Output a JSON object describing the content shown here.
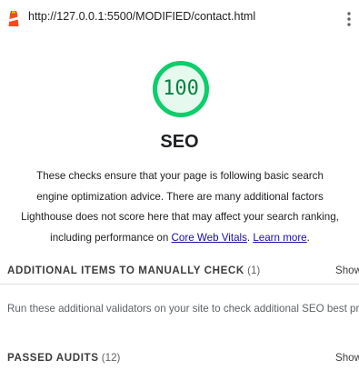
{
  "browser": {
    "url": "http://127.0.0.1:5500/MODIFIED/contact.html",
    "logo_icon": "lighthouse-icon",
    "menu_icon": "vertical-ellipsis-icon"
  },
  "category": {
    "score": "100",
    "score_fraction": 1.0,
    "title": "SEO",
    "score_color": "#0cce6b",
    "description_intro": "These checks ensure that your page is following basic search engine optimization advice. There are many additional factors Lighthouse does not score here that may affect your search ranking, including performance on ",
    "link_core_web_vitals": "Core Web Vitals",
    "separator": ". ",
    "link_learn_more": "Learn more",
    "description_end": "."
  },
  "groups": {
    "manual": {
      "title": "ADDITIONAL ITEMS TO MANUALLY CHECK",
      "count": "(1)",
      "show_label": "Show",
      "description": "Run these additional validators on your site to check additional SEO best practices."
    },
    "passed": {
      "title": "PASSED AUDITS",
      "count": "(12)",
      "show_label": "Show"
    }
  },
  "colors": {
    "pass_green": "#0cce6b",
    "pass_fill": "#e6f9ee",
    "score_text": "#0b8043",
    "link": "#1a0dab",
    "logo_red": "#f44b21"
  }
}
